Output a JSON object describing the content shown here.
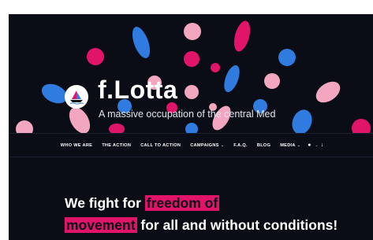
{
  "site": {
    "title": "f.Lotta",
    "tagline": "A massive occupation of the central Med",
    "logo_icon": "sailboat-logo-icon"
  },
  "nav": {
    "items": [
      {
        "label": "WHO WE ARE"
      },
      {
        "label": "THE ACTION"
      },
      {
        "label": "CALL TO ACTION"
      },
      {
        "label": "CAMPAIGNS",
        "dropdown": true
      },
      {
        "label": "F.A.Q."
      },
      {
        "label": "BLOG"
      },
      {
        "label": "MEDIA",
        "dropdown": true
      }
    ],
    "extra_icons": [
      "speech-bubble-icon",
      "chevron-down-icon",
      "download-arrow-icon"
    ]
  },
  "headline": {
    "part1": "We fight for ",
    "highlight1": "freedom of",
    "highlight2": "movement",
    "part2": " for all and without conditions!"
  },
  "colors": {
    "background": "#0a0d15",
    "pink_accent": "#e0156a",
    "light_pink": "#f2a6c0",
    "blue": "#2f7be0"
  }
}
